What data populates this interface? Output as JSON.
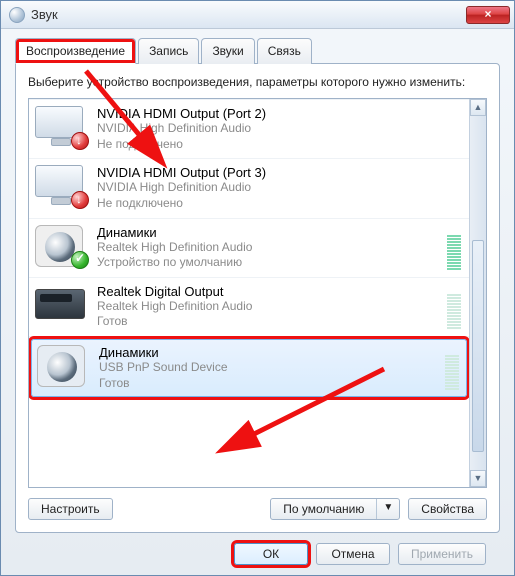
{
  "window": {
    "title": "Звук",
    "close_glyph": "×"
  },
  "tabs": [
    {
      "label": "Воспроизведение"
    },
    {
      "label": "Запись"
    },
    {
      "label": "Звуки"
    },
    {
      "label": "Связь"
    }
  ],
  "instruction": "Выберите устройство воспроизведения, параметры которого нужно изменить:",
  "devices": [
    {
      "name": "NVIDIA HDMI Output (Port 2)",
      "sub1": "NVIDIA High Definition Audio",
      "sub2": "Не подключено"
    },
    {
      "name": "NVIDIA HDMI Output (Port 3)",
      "sub1": "NVIDIA High Definition Audio",
      "sub2": "Не подключено"
    },
    {
      "name": "Динамики",
      "sub1": "Realtek High Definition Audio",
      "sub2": "Устройство по умолчанию"
    },
    {
      "name": "Realtek Digital Output",
      "sub1": "Realtek High Definition Audio",
      "sub2": "Готов"
    },
    {
      "name": "Динамики",
      "sub1": "USB PnP Sound Device",
      "sub2": "Готов"
    }
  ],
  "buttons": {
    "configure": "Настроить",
    "default": "По умолчанию",
    "properties": "Свойства",
    "ok": "ОК",
    "cancel": "Отмена",
    "apply": "Применить"
  },
  "scroll": {
    "up": "▲",
    "down": "▼"
  },
  "split_arrow": "▼"
}
